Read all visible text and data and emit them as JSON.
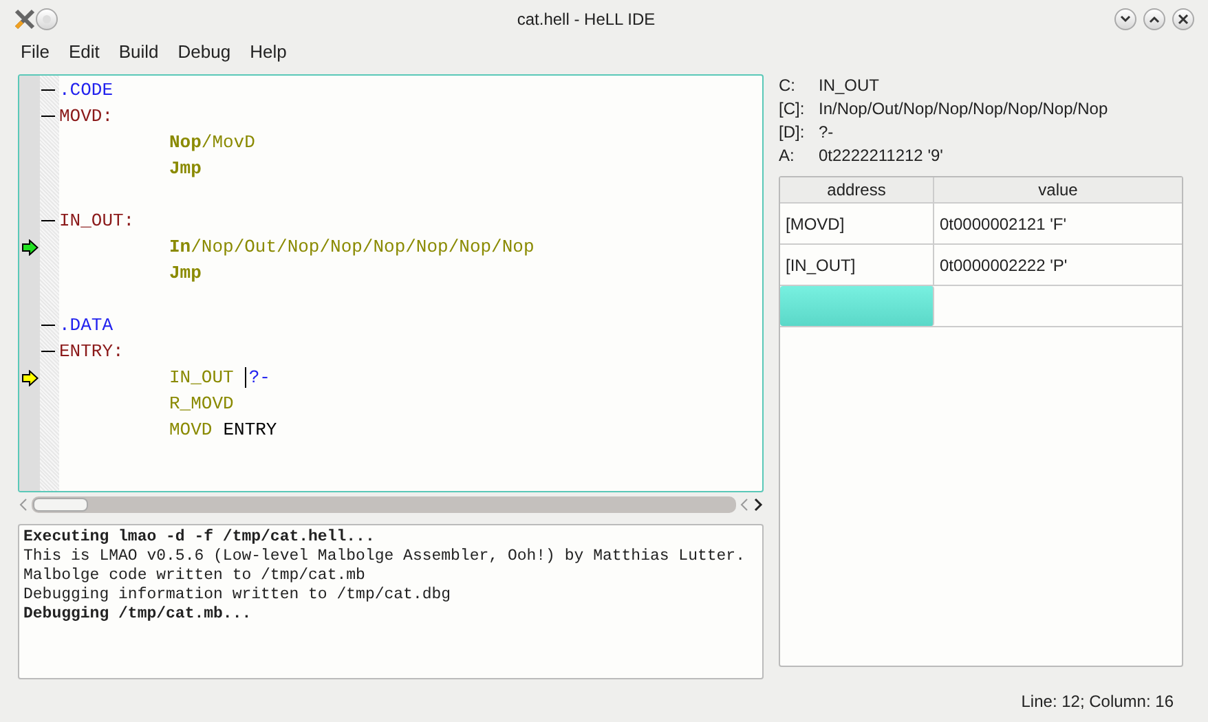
{
  "window": {
    "title": "cat.hell - HeLL IDE"
  },
  "menu": [
    "File",
    "Edit",
    "Build",
    "Debug",
    "Help"
  ],
  "editor": {
    "lines": [
      {
        "kind": "heading",
        "tokens": [
          {
            "kind": "directive",
            "text": ".CODE"
          }
        ]
      },
      {
        "kind": "heading",
        "tokens": [
          {
            "kind": "label",
            "text": "MOVD:"
          }
        ]
      },
      {
        "kind": "instruction",
        "tokens": [
          {
            "kind": "op_bold",
            "text": "Nop"
          },
          {
            "kind": "op",
            "text": "/MovD"
          }
        ]
      },
      {
        "kind": "instruction",
        "tokens": [
          {
            "kind": "op_bold",
            "text": "Jmp"
          }
        ]
      },
      {
        "kind": "blank"
      },
      {
        "kind": "heading",
        "tokens": [
          {
            "kind": "label",
            "text": "IN_OUT:"
          }
        ]
      },
      {
        "kind": "instruction",
        "marker": {
          "kind": "current"
        },
        "tokens": [
          {
            "kind": "op_bold",
            "text": "In"
          },
          {
            "kind": "op",
            "text": "/Nop/Out/Nop/Nop/Nop/Nop/Nop/Nop"
          }
        ]
      },
      {
        "kind": "instruction",
        "tokens": [
          {
            "kind": "op_bold",
            "text": "Jmp"
          }
        ]
      },
      {
        "kind": "blank"
      },
      {
        "kind": "heading",
        "tokens": [
          {
            "kind": "directive",
            "text": ".DATA"
          }
        ]
      },
      {
        "kind": "heading",
        "tokens": [
          {
            "kind": "label",
            "text": "ENTRY:"
          }
        ]
      },
      {
        "kind": "instruction",
        "marker": {
          "kind": "data"
        },
        "tokens": [
          {
            "kind": "ref",
            "text": "IN_OUT"
          },
          {
            "kind": "directive",
            "text": "?-",
            "cursor": true
          }
        ]
      },
      {
        "kind": "instruction",
        "tokens": [
          {
            "kind": "ref",
            "text": "R_MOVD"
          }
        ]
      },
      {
        "kind": "instruction",
        "tokens": [
          {
            "kind": "ref",
            "text": "MOVD"
          },
          {
            "kind": "plain",
            "text": "ENTRY"
          }
        ]
      }
    ]
  },
  "output": [
    {
      "text": "Executing lmao -d -f /tmp/cat.hell...",
      "bold": true
    },
    {
      "text": "This is LMAO v0.5.6 (Low-level Malbolge Assembler, Ooh!) by Matthias Lutter.",
      "bold": false
    },
    {
      "text": "Malbolge code written to /tmp/cat.mb",
      "bold": false
    },
    {
      "text": "Debugging information written to /tmp/cat.dbg",
      "bold": false
    },
    {
      "text": "Debugging /tmp/cat.mb...",
      "bold": true
    }
  ],
  "registers": [
    {
      "label": "C:",
      "value": "IN_OUT"
    },
    {
      "label": "[C]:",
      "value": "In/Nop/Out/Nop/Nop/Nop/Nop/Nop/Nop"
    },
    {
      "label": "[D]:",
      "value": "?-"
    },
    {
      "label": "A:",
      "value": "0t2222211212 '9'"
    }
  ],
  "table": {
    "columns": [
      "address",
      "value"
    ],
    "rows": [
      {
        "address": "[MOVD]",
        "value": "0t0000002121 'F'",
        "selected": false
      },
      {
        "address": "[IN_OUT]",
        "value": "0t0000002222 'P'",
        "selected": false
      },
      {
        "selected": true
      }
    ]
  },
  "status_bar": "Line: 12; Column: 16"
}
